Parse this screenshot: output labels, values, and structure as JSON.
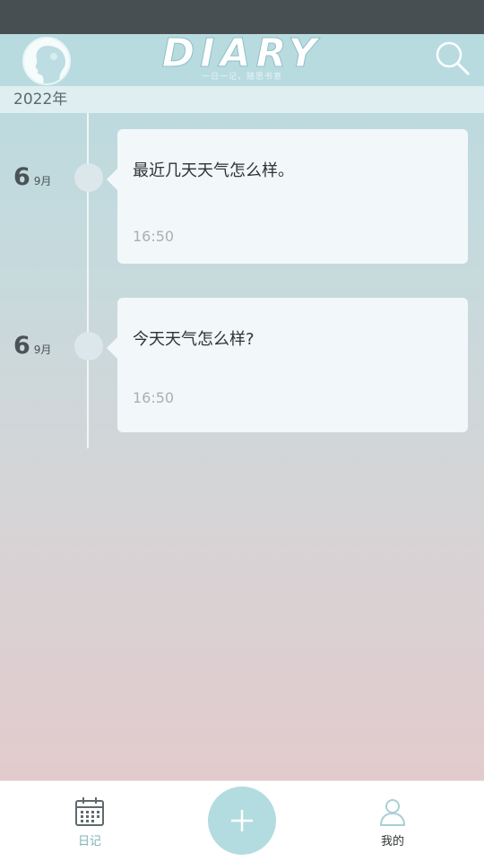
{
  "header": {
    "logo_title": "DIARY",
    "logo_subtitle": "一日一记，随思书意"
  },
  "year_label": "2022年",
  "entries": [
    {
      "day": "6",
      "month": "9月",
      "text": "最近几天天气怎么样。",
      "time": "16:50"
    },
    {
      "day": "6",
      "month": "9月",
      "text": "今天天气怎么样?",
      "time": "16:50"
    }
  ],
  "nav": {
    "diary_label": "日记",
    "mine_label": "我的"
  },
  "colors": {
    "accent": "#b3dce0",
    "header": "#b8dbe0",
    "status_bar": "#474f52",
    "card": "#f2f8fa"
  },
  "icons": {
    "avatar": "avatar-silhouette",
    "search": "search-icon",
    "diary": "calendar-icon",
    "add": "plus-icon",
    "mine": "user-icon"
  }
}
